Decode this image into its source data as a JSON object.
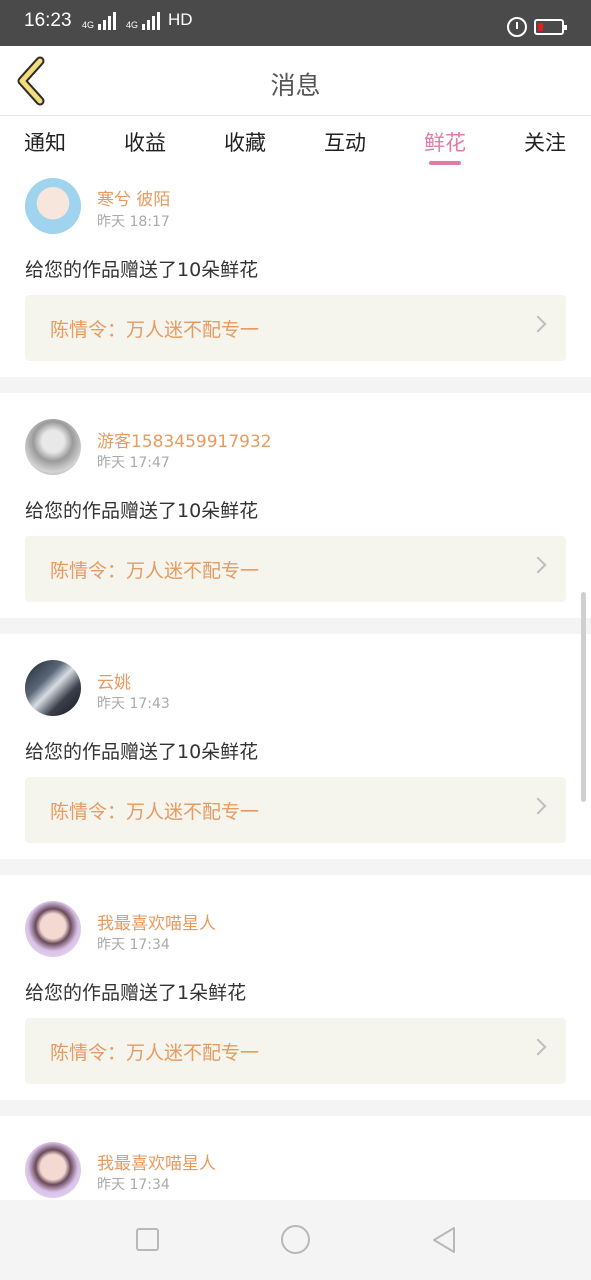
{
  "status_bar": {
    "time": "16:23",
    "net1": "4G",
    "net2": "4G",
    "hd": "HD"
  },
  "header": {
    "title": "消息"
  },
  "tabs": [
    {
      "label": "通知",
      "active": false
    },
    {
      "label": "收益",
      "active": false
    },
    {
      "label": "收藏",
      "active": false
    },
    {
      "label": "互动",
      "active": false
    },
    {
      "label": "鲜花",
      "active": true
    },
    {
      "label": "关注",
      "active": false
    }
  ],
  "colors": {
    "accent": "#e57aa5",
    "name": "#e89a5f",
    "card_bg": "#f5f5ee"
  },
  "messages": [
    {
      "username": "寒兮 彼陌",
      "time": "昨天 18:17",
      "text": "给您的作品赠送了10朵鲜花",
      "work_title": "陈情令：万人迷不配专一"
    },
    {
      "username": "游客1583459917932",
      "time": "昨天 17:47",
      "text": "给您的作品赠送了10朵鲜花",
      "work_title": "陈情令：万人迷不配专一"
    },
    {
      "username": "云姚",
      "time": "昨天 17:43",
      "text": "给您的作品赠送了10朵鲜花",
      "work_title": "陈情令：万人迷不配专一"
    },
    {
      "username": "我最喜欢喵星人",
      "time": "昨天 17:34",
      "text": "给您的作品赠送了1朵鲜花",
      "work_title": "陈情令：万人迷不配专一"
    },
    {
      "username": "我最喜欢喵星人",
      "time": "昨天 17:34"
    }
  ]
}
